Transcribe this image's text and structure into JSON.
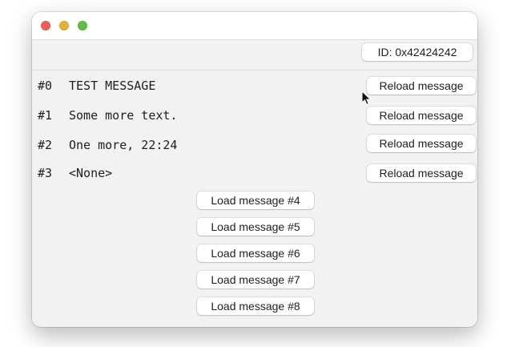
{
  "window": {
    "traffic_lights": [
      {
        "name": "close",
        "color": "#ec5f56"
      },
      {
        "name": "minimize",
        "color": "#e0b03a"
      },
      {
        "name": "zoom",
        "color": "#5abf42"
      }
    ]
  },
  "header": {
    "id_label": "ID: 0x42424242"
  },
  "messages": [
    {
      "index": "#0",
      "text": "TEST MESSAGE",
      "action": "Reload message"
    },
    {
      "index": "#1",
      "text": "Some more text.",
      "action": "Reload message"
    },
    {
      "index": "#2",
      "text": "One more, 22:24",
      "action": "Reload message"
    },
    {
      "index": "#3",
      "text": "<None>",
      "action": "Reload message"
    }
  ],
  "load_buttons": [
    "Load message #4",
    "Load message #5",
    "Load message #6",
    "Load message #7",
    "Load message #8"
  ]
}
